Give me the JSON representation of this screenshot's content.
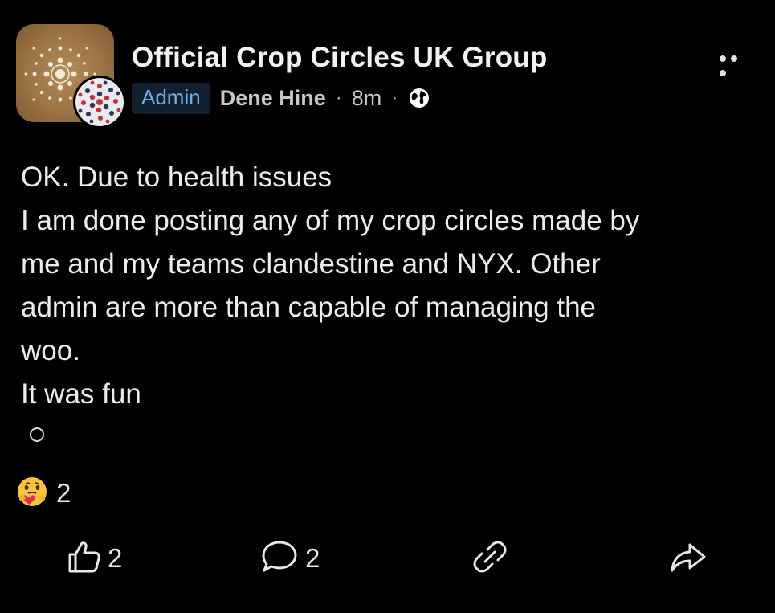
{
  "post": {
    "group_name": "Official Crop Circles UK Group",
    "badge": "Admin",
    "author": "Dene Hine",
    "separator": "·",
    "time": "8m",
    "body_lines": [
      "OK. Due to health issues",
      "I am done posting any of my crop circles made by",
      "me and my teams clandestine and NYX. Other",
      "admin are more than capable of managing the",
      "woo.",
      "It was fun"
    ]
  },
  "reactions": {
    "icon": "care-reaction-icon",
    "count": "2"
  },
  "actions": {
    "like_count": "2",
    "comment_count": "2"
  },
  "colors": {
    "background": "#000000",
    "admin_badge_text": "#6fb3ea",
    "admin_badge_bg": "#10202e",
    "text": "#ececec"
  }
}
